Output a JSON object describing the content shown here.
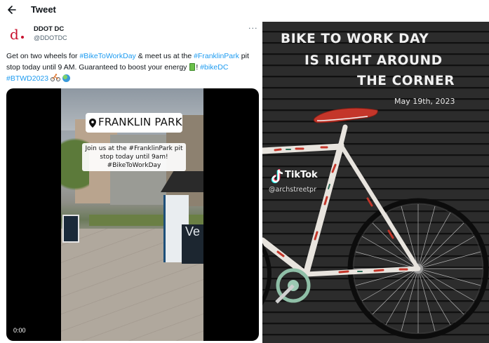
{
  "topbar": {
    "back_icon": "arrow-left-icon",
    "title": "Tweet"
  },
  "tweet": {
    "display_name": "DDOT DC",
    "handle": "@DDOTDC",
    "avatar_letter": "d",
    "more": "···",
    "text": {
      "part1": "Get on two wheels for ",
      "tag1": "#BikeToWorkDay",
      "part2": " & meet us at the ",
      "tag2": "#FranklinPark",
      "part3": " pit stop today until 9 AM. Guaranteed to boost your energy ",
      "part4": "! ",
      "tag3": "#bikeDC",
      "tag4": "#BTWD2023",
      "emoji1": "battery-emoji",
      "emoji2": "cyclist-emoji",
      "emoji3": "globe-emoji"
    }
  },
  "video": {
    "location_label": "FRANKLIN PARK",
    "caption_lines": [
      "Join us at the #FranklinPark pit",
      "stop today until 9am!",
      "#BikeToWorkDay"
    ],
    "sign_text": "Ve",
    "timestamp": "0:00"
  },
  "tiktok_image": {
    "headline": [
      "BIKE TO WORK DAY",
      "IS RIGHT AROUND",
      "THE CORNER"
    ],
    "date": "May 19th, 2023",
    "brand": "TikTok",
    "handle": "@archstreetpr"
  },
  "colors": {
    "link": "#1d9bf0",
    "ddot_red": "#c8102e",
    "bike_red": "#c4362a"
  }
}
